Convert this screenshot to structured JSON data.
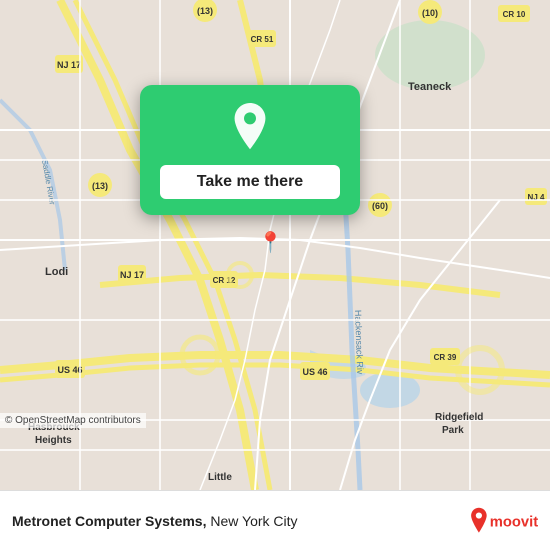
{
  "map": {
    "attribution": "© OpenStreetMap contributors",
    "background_color": "#e8e0d8"
  },
  "popup": {
    "button_label": "Take me there",
    "pin_color": "#ffffff"
  },
  "bottom_bar": {
    "title": "Metronet Computer Systems,",
    "city": " New York City",
    "moovit_alt": "moovit"
  },
  "roads": {
    "highway_color": "#f5e97a",
    "road_color": "#ffffff",
    "minor_road_color": "#f0ebe3"
  }
}
